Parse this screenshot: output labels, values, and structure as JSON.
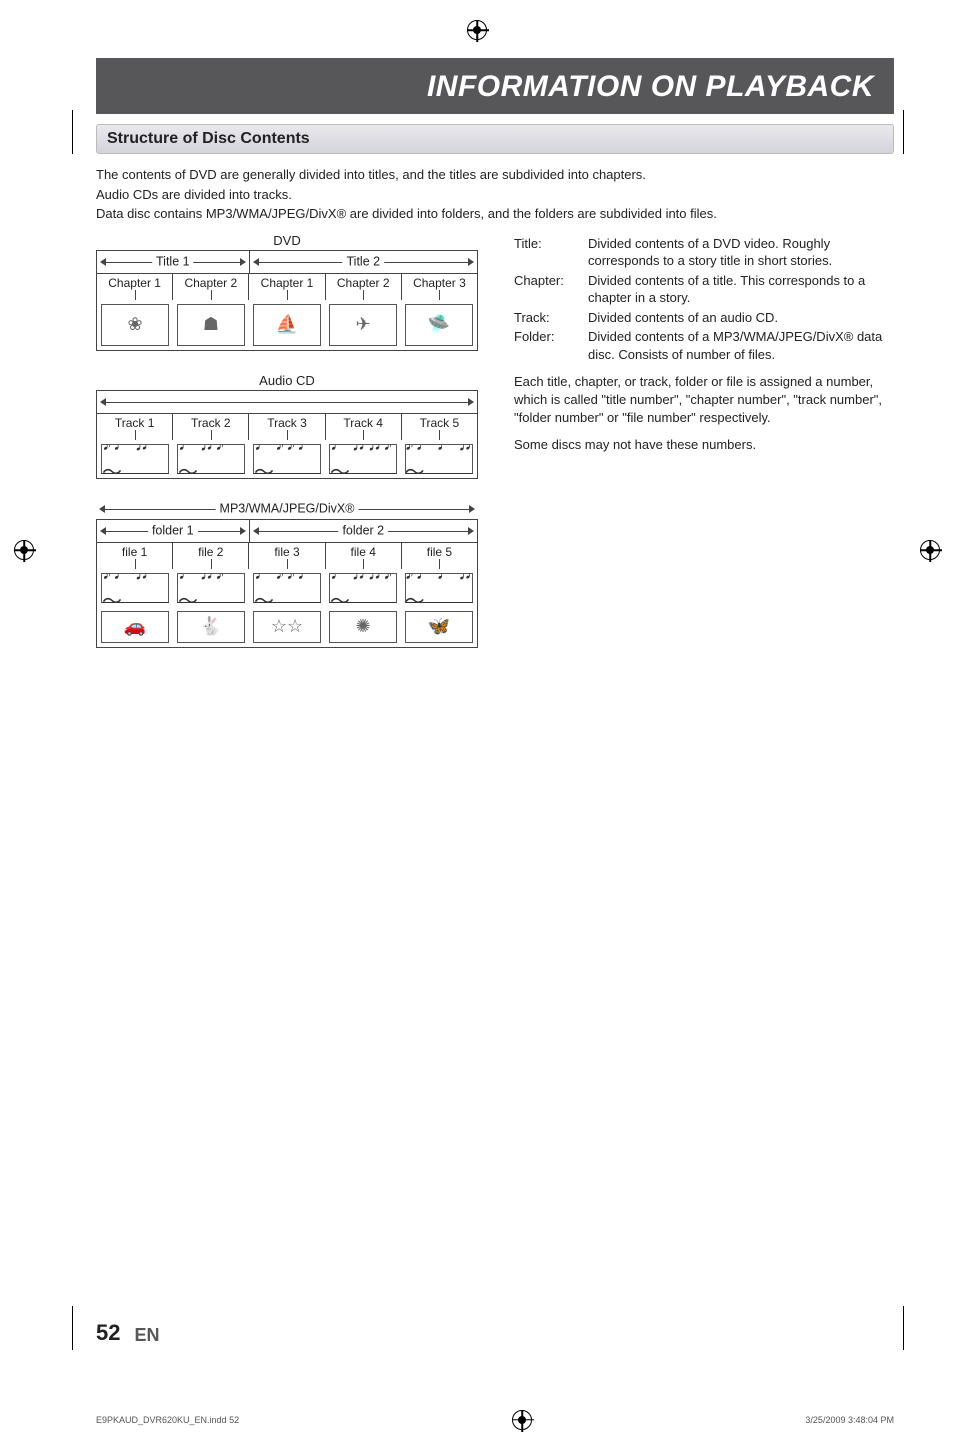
{
  "banner": "INFORMATION ON PLAYBACK",
  "section_title": "Structure of Disc Contents",
  "intro": {
    "p1": "The contents of DVD are generally divided into titles, and the titles are subdivided into chapters.",
    "p2": "Audio CDs are divided into tracks.",
    "p3": "Data disc contains MP3/WMA/JPEG/DivX® are divided into folders, and the folders are subdivided into files."
  },
  "diagrams": {
    "dvd": {
      "title": "DVD",
      "groups": [
        {
          "label": "Title 1",
          "units": [
            "Chapter 1",
            "Chapter 2"
          ]
        },
        {
          "label": "Title 2",
          "units": [
            "Chapter 1",
            "Chapter 2",
            "Chapter 3"
          ]
        }
      ]
    },
    "audio_cd": {
      "title": "Audio CD",
      "units": [
        "Track 1",
        "Track 2",
        "Track 3",
        "Track 4",
        "Track 5"
      ]
    },
    "data": {
      "title": "MP3/WMA/JPEG/DivX®",
      "groups": [
        {
          "label": "folder 1",
          "units": [
            "file 1",
            "file 2"
          ]
        },
        {
          "label": "folder 2",
          "units": [
            "file 3",
            "file 4",
            "file 5"
          ]
        }
      ]
    }
  },
  "definitions": {
    "title_term": "Title:",
    "title_body": "Divided contents of a DVD video. Roughly corresponds to a story title in short stories.",
    "chapter_term": "Chapter:",
    "chapter_body": "Divided contents of a title. This corresponds to a chapter in a story.",
    "track_term": "Track:",
    "track_body": "Divided contents of an audio CD.",
    "folder_term": "Folder:",
    "folder_body": "Divided contents of a MP3/WMA/JPEG/DivX® data disc. Consists of number of files."
  },
  "para1": "Each title, chapter, or track, folder or file is assigned a number, which is called \"title number\", \"chapter number\", \"track number\", \"folder number\" or \"file number\" respectively.",
  "para2": "Some discs may not have these numbers.",
  "footer": {
    "page_number": "52",
    "lang": "EN",
    "file_info": "E9PKAUD_DVR620KU_EN.indd   52",
    "timestamp": "3/25/2009   3:48:04 PM"
  }
}
